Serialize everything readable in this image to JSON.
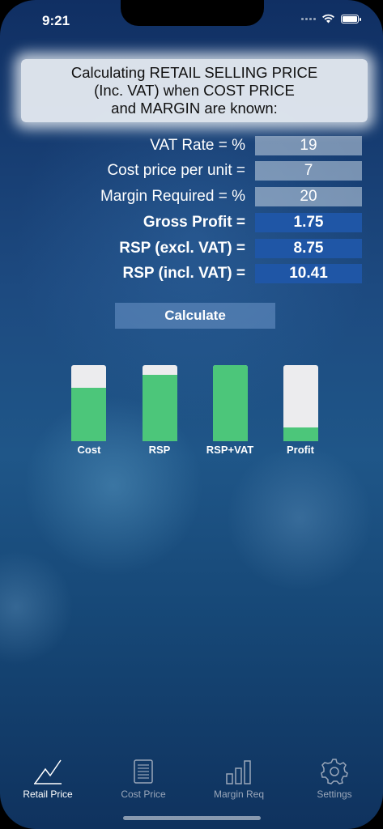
{
  "status": {
    "time": "9:21"
  },
  "header": {
    "text": "Calculating RETAIL SELLING PRICE\n(Inc. VAT) when COST PRICE\nand MARGIN are known:"
  },
  "form": {
    "vat": {
      "label": "VAT Rate = %",
      "value": "19"
    },
    "cost": {
      "label": "Cost price per unit =",
      "value": "7"
    },
    "margin": {
      "label": "Margin Required = %",
      "value": "20"
    },
    "gross": {
      "label": "Gross Profit =",
      "value": "1.75"
    },
    "rsp_ex": {
      "label": "RSP (excl. VAT) =",
      "value": "8.75"
    },
    "rsp_inc": {
      "label": "RSP (incl. VAT) =",
      "value": "10.41"
    }
  },
  "calculate_label": "Calculate",
  "bars": [
    {
      "label": "Cost",
      "fraction": 0.7
    },
    {
      "label": "RSP",
      "fraction": 0.87
    },
    {
      "label": "RSP+VAT",
      "fraction": 1.0
    },
    {
      "label": "Profit",
      "fraction": 0.18
    }
  ],
  "colors": {
    "bar_fill": "#4cc67a",
    "bar_track": "#ececee",
    "output_field": "#1f56a6"
  },
  "tabs": [
    {
      "label": "Retail Price",
      "icon": "line-chart-icon",
      "active": true
    },
    {
      "label": "Cost Price",
      "icon": "receipt-icon",
      "active": false
    },
    {
      "label": "Margin Req",
      "icon": "bar-chart-icon",
      "active": false
    },
    {
      "label": "Settings",
      "icon": "gear-icon",
      "active": false
    }
  ]
}
